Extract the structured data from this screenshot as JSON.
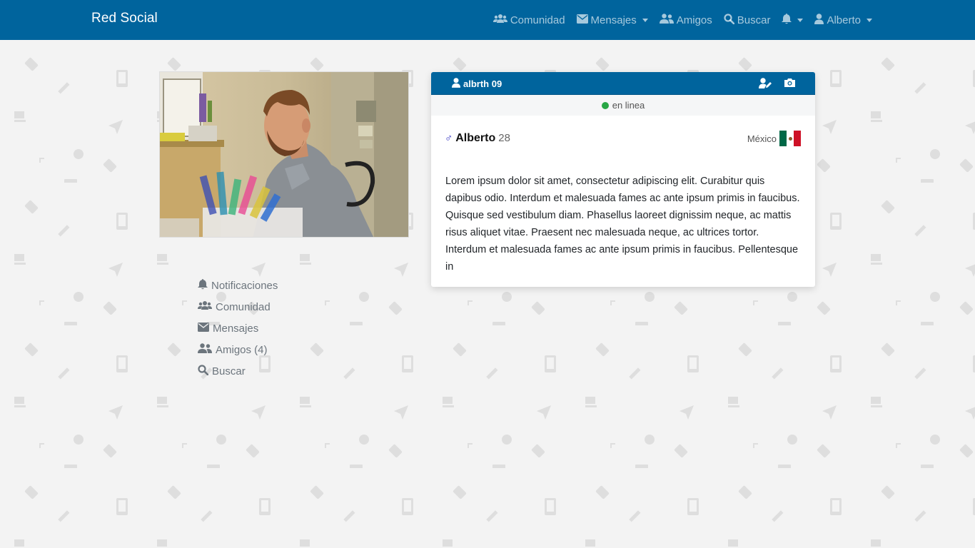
{
  "navbar": {
    "brand": "Red Social",
    "items": [
      {
        "label": "Comunidad",
        "icon": "users-icon"
      },
      {
        "label": "Mensajes",
        "icon": "envelope-icon",
        "dropdown": true
      },
      {
        "label": "Amigos",
        "icon": "user-friends-icon"
      },
      {
        "label": "Buscar",
        "icon": "search-icon"
      },
      {
        "label": "",
        "icon": "bell-icon",
        "dropdown": true
      },
      {
        "label": "Alberto",
        "icon": "user-icon",
        "dropdown": true
      }
    ]
  },
  "side_menu": {
    "items": [
      {
        "label": "Notificaciones",
        "icon": "bell-icon"
      },
      {
        "label": "Comunidad",
        "icon": "users-icon"
      },
      {
        "label": "Mensajes",
        "icon": "envelope-icon"
      },
      {
        "label": "Amigos (4)",
        "icon": "user-friends-icon"
      },
      {
        "label": "Buscar",
        "icon": "search-icon"
      }
    ]
  },
  "profile": {
    "username": "albrth 09",
    "status": "en linea",
    "gender_symbol": "♂",
    "name": "Alberto",
    "age": "28",
    "country": "México",
    "bio": "Lorem ipsum dolor sit amet, consectetur adipiscing elit. Curabitur quis dapibus odio. Interdum et malesuada fames ac ante ipsum primis in faucibus. Quisque sed vestibulum diam. Phasellus laoreet dignissim neque, ac mattis risus aliquet vitae. Praesent nec malesuada neque, ac ultrices tortor. Interdum et malesuada fames ac ante ipsum primis in faucibus. Pellentesque in"
  },
  "colors": {
    "navbar": "#00649d",
    "online": "#28a745",
    "background": "#f3f3f3"
  }
}
